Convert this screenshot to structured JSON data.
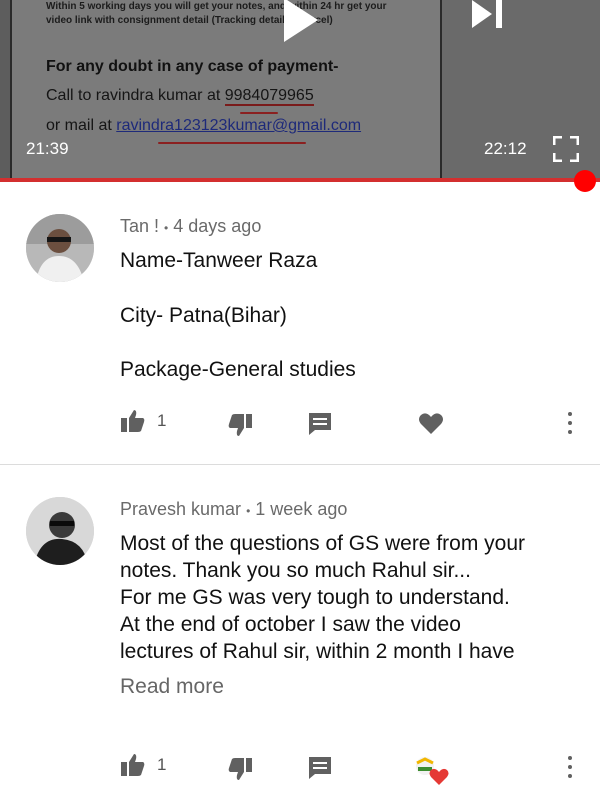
{
  "video": {
    "doc_line1": "Within 5 working days you will get your notes, and within 24 hr get your",
    "doc_line2": "video link with consignment detail (Tracking detail of parcel)",
    "doc_heading": "For any doubt in any case of payment-",
    "doc_call_prefix": "Call to ravindra kumar at ",
    "doc_phone": "9984079965",
    "doc_mail_prefix": "or mail at ",
    "doc_email": "ravindra123123kumar@gmail.com",
    "current_time": "21:39",
    "duration": "22:12",
    "progress": 0.975,
    "progress_color": "#ff0000"
  },
  "icons": {
    "play": "play-icon",
    "next": "skip-next-icon",
    "fullscreen": "fullscreen-icon",
    "like": "thumb-up-icon",
    "dislike": "thumb-down-icon",
    "reply": "comment-icon",
    "heart": "heart-icon",
    "more": "more-vert-icon"
  },
  "comments": [
    {
      "author": "Tan !",
      "separator": "•",
      "time": "4 days ago",
      "lines": [
        "Name-Tanweer Raza",
        "City- Patna(Bihar)",
        "Package-General studies"
      ],
      "likes": "1",
      "hearted_by_creator": false
    },
    {
      "author": "Pravesh kumar",
      "separator": "•",
      "time": "1 week ago",
      "lines": [
        "Most of the questions of GS were from your",
        "notes. Thank you so much Rahul sir...",
        "For me GS was very tough to understand.",
        "At the end of october I saw the video",
        "lectures of Rahul sir, within 2 month I have"
      ],
      "read_more": "Read more",
      "likes": "1",
      "hearted_by_creator": true,
      "heart_color": "#e53935"
    }
  ]
}
